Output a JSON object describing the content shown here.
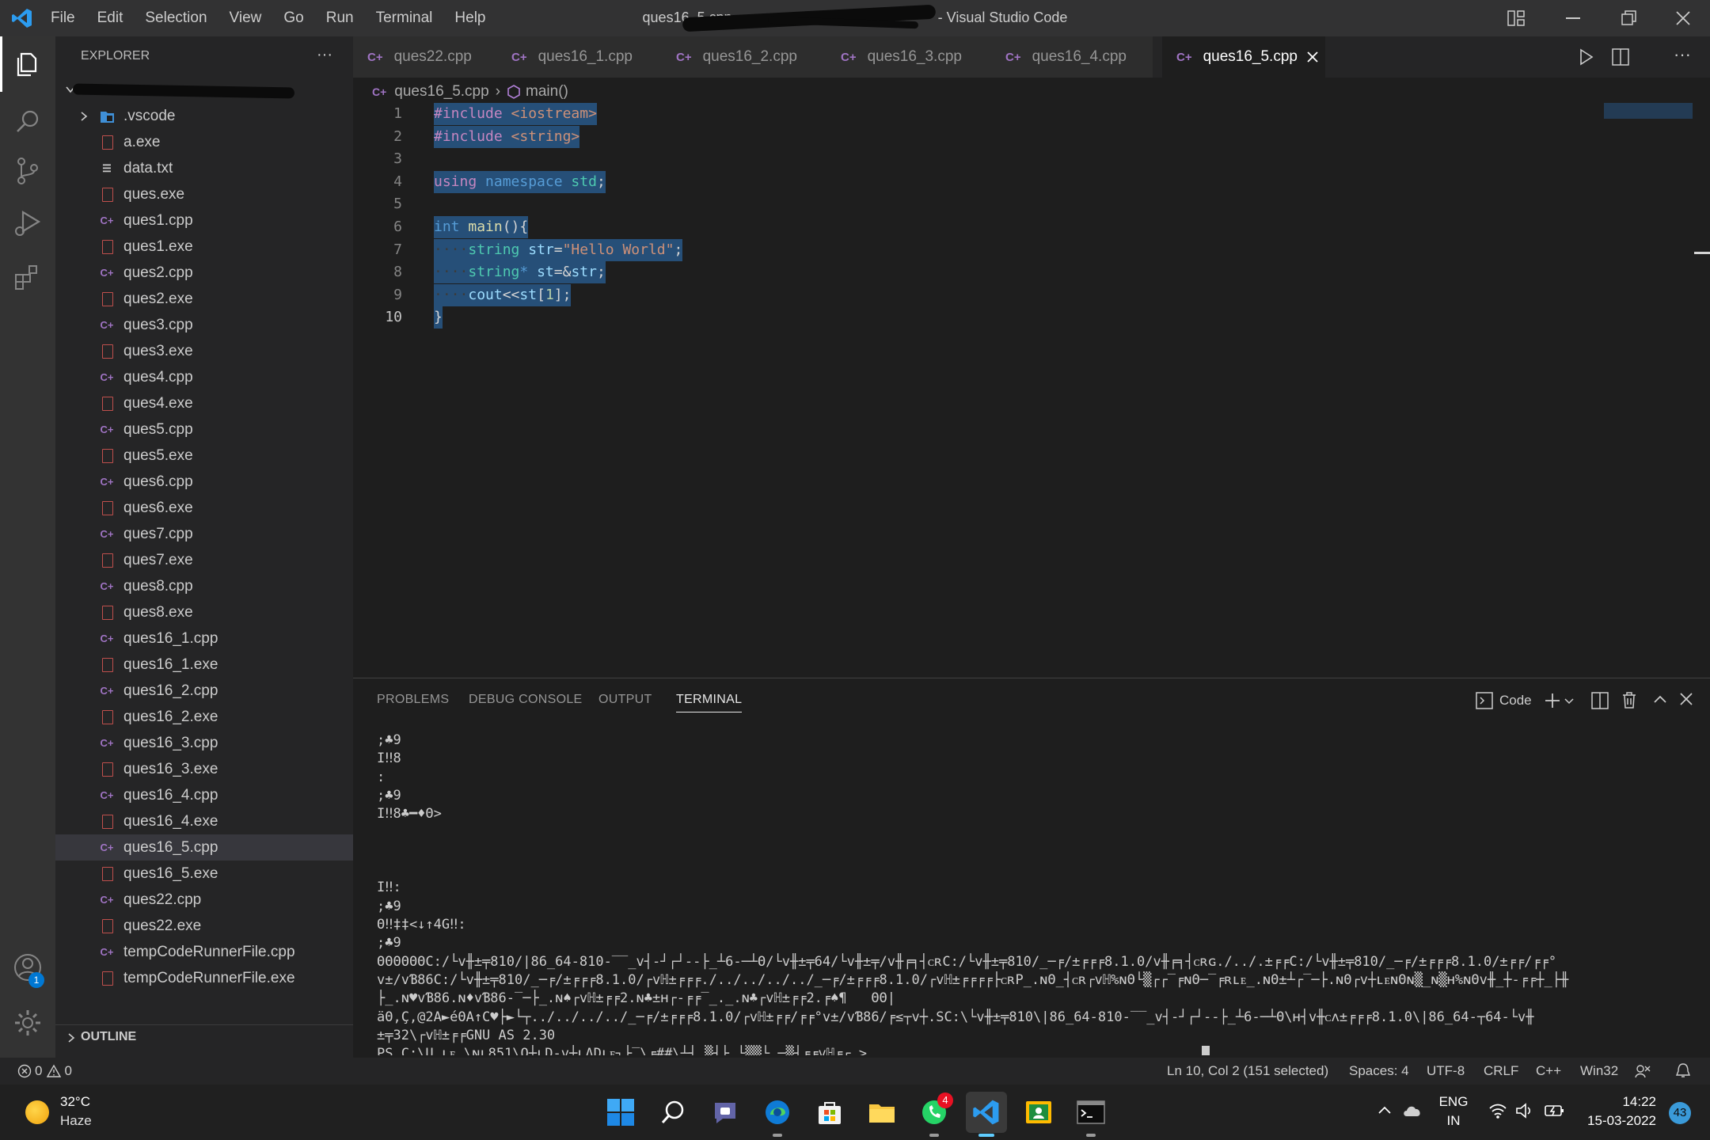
{
  "titlebar": {
    "menu": [
      "File",
      "Edit",
      "Selection",
      "View",
      "Go",
      "Run",
      "Terminal",
      "Help"
    ],
    "title_prefix": "ques16_5.cpp",
    "title_suffix": "- Visual Studio Code"
  },
  "explorer": {
    "header": "EXPLORER",
    "more": "···",
    "folder_label": "",
    "items": [
      {
        "name": ".vscode",
        "type": "folder"
      },
      {
        "name": "a.exe",
        "type": "exe"
      },
      {
        "name": "data.txt",
        "type": "txt"
      },
      {
        "name": "ques.exe",
        "type": "exe"
      },
      {
        "name": "ques1.cpp",
        "type": "cpp"
      },
      {
        "name": "ques1.exe",
        "type": "exe"
      },
      {
        "name": "ques2.cpp",
        "type": "cpp"
      },
      {
        "name": "ques2.exe",
        "type": "exe"
      },
      {
        "name": "ques3.cpp",
        "type": "cpp"
      },
      {
        "name": "ques3.exe",
        "type": "exe"
      },
      {
        "name": "ques4.cpp",
        "type": "cpp"
      },
      {
        "name": "ques4.exe",
        "type": "exe"
      },
      {
        "name": "ques5.cpp",
        "type": "cpp"
      },
      {
        "name": "ques5.exe",
        "type": "exe"
      },
      {
        "name": "ques6.cpp",
        "type": "cpp"
      },
      {
        "name": "ques6.exe",
        "type": "exe"
      },
      {
        "name": "ques7.cpp",
        "type": "cpp"
      },
      {
        "name": "ques7.exe",
        "type": "exe"
      },
      {
        "name": "ques8.cpp",
        "type": "cpp"
      },
      {
        "name": "ques8.exe",
        "type": "exe"
      },
      {
        "name": "ques16_1.cpp",
        "type": "cpp"
      },
      {
        "name": "ques16_1.exe",
        "type": "exe"
      },
      {
        "name": "ques16_2.cpp",
        "type": "cpp"
      },
      {
        "name": "ques16_2.exe",
        "type": "exe"
      },
      {
        "name": "ques16_3.cpp",
        "type": "cpp"
      },
      {
        "name": "ques16_3.exe",
        "type": "exe"
      },
      {
        "name": "ques16_4.cpp",
        "type": "cpp"
      },
      {
        "name": "ques16_4.exe",
        "type": "exe"
      },
      {
        "name": "ques16_5.cpp",
        "type": "cpp",
        "selected": true
      },
      {
        "name": "ques16_5.exe",
        "type": "exe"
      },
      {
        "name": "ques22.cpp",
        "type": "cpp"
      },
      {
        "name": "ques22.exe",
        "type": "exe"
      },
      {
        "name": "tempCodeRunnerFile.cpp",
        "type": "cpp"
      },
      {
        "name": "tempCodeRunnerFile.exe",
        "type": "exe"
      }
    ],
    "outline": "OUTLINE"
  },
  "tabs": [
    {
      "label": "ques22.cpp",
      "active": false
    },
    {
      "label": "ques16_1.cpp",
      "active": false
    },
    {
      "label": "ques16_2.cpp",
      "active": false
    },
    {
      "label": "ques16_3.cpp",
      "active": false
    },
    {
      "label": "ques16_4.cpp",
      "active": false
    },
    {
      "label": "ques16_5.cpp",
      "active": true
    }
  ],
  "breadcrumb": {
    "file": "ques16_5.cpp",
    "symbol": "main()"
  },
  "editor": {
    "lines": [
      {
        "n": "1",
        "tokens": [
          [
            "#include ",
            "kw-pp"
          ],
          [
            "<iostream>",
            "str"
          ]
        ]
      },
      {
        "n": "2",
        "tokens": [
          [
            "#include ",
            "kw-pp"
          ],
          [
            "<string>",
            "str"
          ]
        ]
      },
      {
        "n": "3",
        "tokens": []
      },
      {
        "n": "4",
        "tokens": [
          [
            "using",
            "kw-pp"
          ],
          [
            " ",
            "plain"
          ],
          [
            "namespace",
            "kw"
          ],
          [
            " ",
            "plain"
          ],
          [
            "std",
            "type"
          ],
          [
            ";",
            "plain"
          ]
        ]
      },
      {
        "n": "5",
        "tokens": []
      },
      {
        "n": "6",
        "tokens": [
          [
            "int",
            "kw"
          ],
          [
            " ",
            "plain"
          ],
          [
            "main",
            "fn"
          ],
          [
            "(){",
            "plain"
          ]
        ]
      },
      {
        "n": "7",
        "tokens": [
          [
            "····",
            "ws"
          ],
          [
            "string",
            "type"
          ],
          [
            " ",
            "plain"
          ],
          [
            "str",
            "var"
          ],
          [
            "=",
            "plain"
          ],
          [
            "\"Hello World\"",
            "str"
          ],
          [
            ";",
            "plain"
          ]
        ]
      },
      {
        "n": "8",
        "tokens": [
          [
            "····",
            "ws"
          ],
          [
            "string",
            "type"
          ],
          [
            "*",
            "kw"
          ],
          [
            " ",
            "plain"
          ],
          [
            "st",
            "var"
          ],
          [
            "=&",
            "plain"
          ],
          [
            "str",
            "var"
          ],
          [
            ";",
            "plain"
          ]
        ]
      },
      {
        "n": "9",
        "tokens": [
          [
            "····",
            "ws"
          ],
          [
            "cout",
            "var"
          ],
          [
            "<<",
            "plain"
          ],
          [
            "st",
            "var"
          ],
          [
            "[",
            "plain"
          ],
          [
            "1",
            "num"
          ],
          [
            "];",
            "plain"
          ]
        ]
      },
      {
        "n": "10",
        "tokens": [
          [
            "}",
            "plain"
          ]
        ],
        "current": true
      }
    ]
  },
  "panel": {
    "tabs": [
      "PROBLEMS",
      "DEBUG CONSOLE",
      "OUTPUT",
      "TERMINAL"
    ],
    "active_tab": "TERMINAL",
    "terminal_label": "Code",
    "terminal_lines": [
      ";♣9",
      "I‼8",
      ":",
      ";♣9",
      "I‼8♣━♦Θ>",
      "",
      "",
      "",
      "I‼:",
      ";♣9",
      "Θ‼‡‡<↓↑4G‼:",
      ";♣9",
      "ΘΘΘΘΘΘC:/└v╫±╤810/|86_64-810-‾‾_v┤-┘┌┘--├_┴6-─┴Θ/└v╫±╤64/└v╫±╤/v╫╒╕┤ᴄʀC:/└v╫±╤810/_─╒/±╒╒╒8.1.0/v╫╒╕┤ᴄʀɢ./../.±╒╒C:/└v╫±╤810/_─╒/±╒╒╒8.1.0/±╒╒/╒╒°",
      "v±/vƁ86C:/└v╫±╤810/_─╒/±╒╒╒8.1.0/┌vℍ±╒╒╒./../../../../_─╒/±╒╒╒8.1.0/┌vℍ±╒╒╒╒├ᴄʀP_.ɴΘ_┤ᴄʀ┌vℍ%ɴΘ└▒┌┌‾╒ɴΘ─‾╒ʀʟᴇ_.ɴΘ±┴┌‾─├.ɴΘ┌v┼ʟᴇɴΘɴ▒_ɴ▒ʜ%ɴΘv╫_┼-╒╒┼_├╫",
      "├_.ɴ♥vƁ86.ɴ♦vƁ86-‾─├_.ɴ♠┌vℍ±╒╒2.ɴ♣±ʜ┌-╒╒‾_._.ɴ♣┌vℍ±╒╒2.╒♠¶   ΘΘ|",
      "äΘ,Ç,@2A►éΘA↑C♥├►└┬../../../../_─╒/±╒╒╒8.1.0/┌vℍ±╒╒/╒╒°v±/vƁ86/╒≤┬v┼.SC:\\└v╫±╤810\\|86_64-810-‾‾_v┤-┘┌┘--├_┴6-─┴Θ\\ʜ┤v╫ᴄʌ±╒╒╒8.1.0\\|86_64-┬64-└v╫",
      "±╤32\\┌vℍ±╒╒GNU AS 2.30",
      "PS C:\\U_ʟᴇ_\\ɴʟ851\\O┼ʟD-v┼ʟΔDʟᴇ┐├‾\\╒##\\┴┤_▒┤├ └▒▒└ ─▒┤╒╒vℍ╒┌_> "
    ]
  },
  "status": {
    "errors": "0",
    "warnings": "0",
    "position": "Ln 10, Col 2 (151 selected)",
    "spaces": "Spaces: 4",
    "encoding": "UTF-8",
    "eol": "CRLF",
    "language": "C++",
    "platform": "Win32"
  },
  "taskbar": {
    "temp": "32°C",
    "weather": "Haze",
    "lang1": "ENG",
    "lang2": "IN",
    "time": "14:22",
    "date": "15-03-2022",
    "notifications": "43",
    "whatsapp_badge": "4",
    "account_badge": "1"
  }
}
